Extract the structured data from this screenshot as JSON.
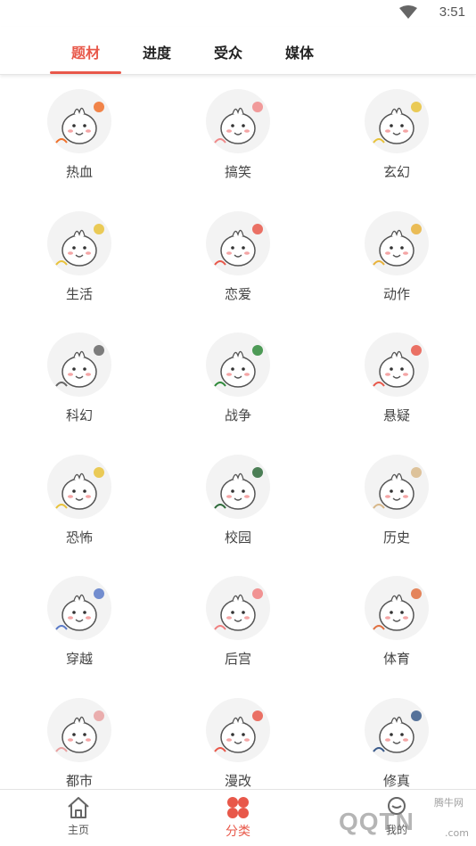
{
  "status_bar": {
    "time": "3:51"
  },
  "tabs": [
    {
      "label": "题材",
      "active": true
    },
    {
      "label": "进度",
      "active": false
    },
    {
      "label": "受众",
      "active": false
    },
    {
      "label": "媒体",
      "active": false
    }
  ],
  "categories": [
    {
      "label": "热血",
      "icon": "fire-mascot-icon",
      "accent": "#f0702a"
    },
    {
      "label": "搞笑",
      "icon": "laughing-mascot-icon",
      "accent": "#f08a8a"
    },
    {
      "label": "玄幻",
      "icon": "fantasy-mascot-icon",
      "accent": "#e8c23a"
    },
    {
      "label": "生活",
      "icon": "life-mascot-icon",
      "accent": "#e8c23a"
    },
    {
      "label": "恋爱",
      "icon": "love-mascot-icon",
      "accent": "#e8584a"
    },
    {
      "label": "动作",
      "icon": "action-mascot-icon",
      "accent": "#e8b23a"
    },
    {
      "label": "科幻",
      "icon": "ufo-mascot-icon",
      "accent": "#666666"
    },
    {
      "label": "战争",
      "icon": "war-mascot-icon",
      "accent": "#2f8a3a"
    },
    {
      "label": "悬疑",
      "icon": "mystery-mascot-icon",
      "accent": "#e8584a"
    },
    {
      "label": "恐怖",
      "icon": "horror-mascot-icon",
      "accent": "#e8c23a"
    },
    {
      "label": "校园",
      "icon": "school-mascot-icon",
      "accent": "#2e6a3a"
    },
    {
      "label": "历史",
      "icon": "history-mascot-icon",
      "accent": "#d8b88a"
    },
    {
      "label": "穿越",
      "icon": "time-travel-mascot-icon",
      "accent": "#5a7ac8"
    },
    {
      "label": "后宫",
      "icon": "palace-mascot-icon",
      "accent": "#f08080"
    },
    {
      "label": "体育",
      "icon": "basketball-mascot-icon",
      "accent": "#e07040"
    },
    {
      "label": "都市",
      "icon": "city-mascot-icon",
      "accent": "#e8a0a0"
    },
    {
      "label": "漫改",
      "icon": "comic-mascot-icon",
      "accent": "#e8584a"
    },
    {
      "label": "修真",
      "icon": "cultivation-mascot-icon",
      "accent": "#3a5a8a"
    }
  ],
  "bottom_nav": [
    {
      "label": "主页",
      "icon": "home-icon",
      "active": false
    },
    {
      "label": "分类",
      "icon": "category-icon",
      "active": true
    },
    {
      "label": "我的",
      "icon": "profile-icon",
      "active": false
    }
  ],
  "watermark": {
    "text": "QQTN",
    "small": "腾牛网",
    "domain": ".com"
  },
  "colors": {
    "accent": "#e8584a",
    "avatar_bg": "#f3f3f3"
  }
}
